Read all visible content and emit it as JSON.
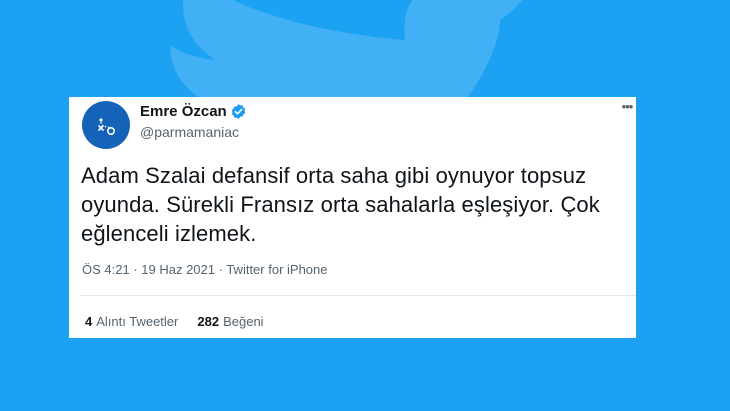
{
  "tweet": {
    "author_name": "Emre Özcan",
    "handle": "@parmamaniac",
    "text": "Adam Szalai defansif orta saha gibi oynuyor topsuz oyunda. Sürekli Fransız orta sahalarla eşleşiyor. Çok eğlenceli izlemek.",
    "time": "ÖS 4:21",
    "date": "19 Haz 2021",
    "source": "Twitter for iPhone",
    "separator": " · ",
    "quote_count": "4",
    "quote_label": "Alıntı Tweetler",
    "like_count": "282",
    "like_label": "Beğeni"
  },
  "icons": {
    "verified": "verified-badge-icon",
    "more": "more-icon",
    "background": "twitter-bird-icon"
  },
  "colors": {
    "background": "#1da1f2",
    "verified": "#1d9bf0",
    "avatar": "#1463b8"
  }
}
